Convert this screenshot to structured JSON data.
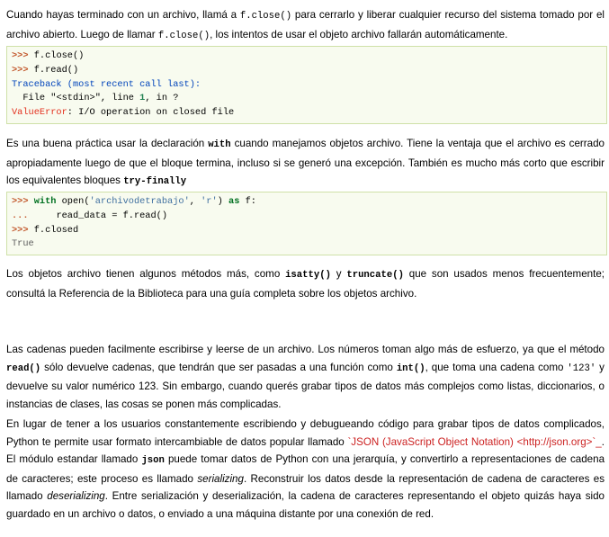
{
  "p1": {
    "t1": "Cuando hayas terminado con un archivo, llamá a ",
    "c1": "f.close()",
    "t2": " para cerrarlo y liberar cualquier recurso del sistema tomado por el archivo abierto. Luego de llamar ",
    "c2": "f.close()",
    "t3": ", los intentos de usar el objeto archivo fallarán automáticamente."
  },
  "code1": {
    "l1_prompt": ">>>",
    "l1_code": " f.close()",
    "l2_prompt": ">>>",
    "l2_code": " f.read()",
    "l3": "Traceback (most recent call last):",
    "l4_a": "  File \"",
    "l4_b": "<stdin>",
    "l4_c": "\", line ",
    "l4_num": "1",
    "l4_d": ", in ?",
    "l5_err": "ValueError",
    "l5_msg": ": I/O operation on closed file"
  },
  "p2": {
    "t1": "Es una buena práctica usar la declaración ",
    "c1": "with",
    "t2": " cuando manejamos objetos archivo. Tiene la ventaja que el archivo es cerrado apropiadamente luego de que el bloque termina, incluso si se generó una excepción. También es mucho más corto que escribir los equivalentes bloques ",
    "c2": "try-finally"
  },
  "code2": {
    "l1_prompt": ">>>",
    "l1_sp": " ",
    "l1_kw": "with",
    "l1_a": " open(",
    "l1_str1": "'archivodetrabajo'",
    "l1_b": ", ",
    "l1_str2": "'r'",
    "l1_c": ") ",
    "l1_kw2": "as",
    "l1_d": " f:",
    "l2_prompt": "...",
    "l2_code": "     read_data = f.read()",
    "l3_prompt": ">>>",
    "l3_code": " f.closed",
    "l4": "True"
  },
  "p3": {
    "t1": "Los objetos archivo tienen algunos métodos más, como ",
    "c1": "isatty()",
    "t2": " y ",
    "c2": "truncate()",
    "t3": " que son usados menos frecuentemente; consultá la Referencia de la Biblioteca para una guía completa sobre los objetos archivo."
  },
  "p4": {
    "t1": "Las cadenas pueden facilmente escribirse y leerse de un archivo. Los números toman algo más de esfuerzo, ya que el método ",
    "c1": "read()",
    "t2": " sólo devuelve cadenas, que tendrán que ser pasadas a una función como ",
    "c2": "int()",
    "t3": ", que toma una cadena como ",
    "c3": "'123'",
    "t4": " y devuelve su valor numérico 123. Sin embargo, cuando querés grabar tipos de datos más complejos como listas, diccionarios, o instancias de clases, las cosas se ponen más complicadas."
  },
  "p5": {
    "t1": "En lugar de tener a los usuarios constantemente escribiendo y debugueando código para grabar tipos de datos complicados, Python te permite usar formato intercambiable de datos popular llamado ",
    "link": "`JSON (JavaScript Object Notation) <http://json.org>`_",
    "t2": ". El módulo estandar llamado ",
    "c1": "json",
    "t3": " puede tomar datos de Python con una jerarquía, y convertirlo a representaciones de cadena de caracteres; este proceso es llamado ",
    "e1": "serializing",
    "t4": ". Reconstruir los datos desde la representación de cadena de caracteres es llamado ",
    "e2": "deserializing",
    "t5": ". Entre serialización y deserialización, la cadena de caracteres representando el objeto quizás haya sido guardado en un archivo o datos, o enviado a una máquina distante por una conexión de red."
  }
}
